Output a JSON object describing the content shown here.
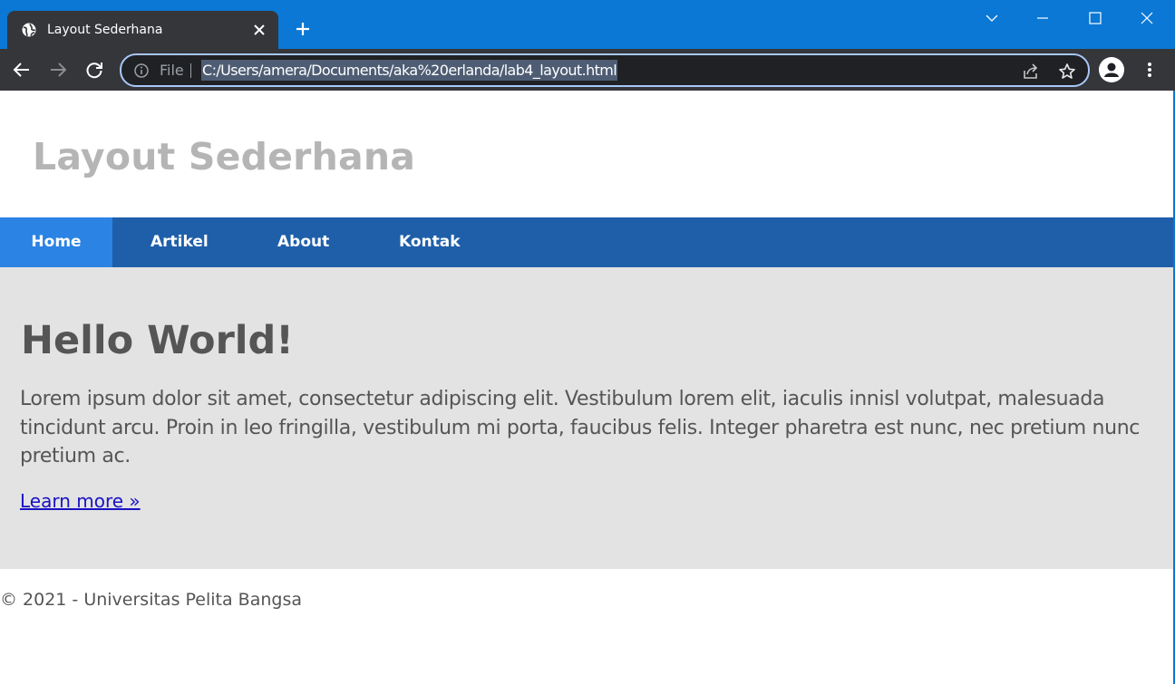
{
  "browser": {
    "tab": {
      "title": "Layout Sederhana"
    },
    "address_bar": {
      "scheme_label": "File",
      "url": "C:/Users/amera/Documents/aka%20erlanda/lab4_layout.html"
    },
    "icons": {
      "favicon": "globe-icon",
      "tab_close": "close-icon",
      "new_tab": "plus-icon",
      "tab_search": "chevron-down-icon",
      "minimize": "minimize-icon",
      "maximize": "maximize-icon",
      "close_window": "close-icon",
      "back": "back-arrow-icon",
      "forward": "forward-arrow-icon",
      "reload": "reload-icon",
      "site_info": "info-icon",
      "share": "share-icon",
      "bookmark": "star-icon",
      "profile": "person-icon",
      "menu": "more-vert-icon"
    },
    "colors": {
      "frame": "#0a78d4",
      "toolbar": "#35363a",
      "omnibox": "#202124"
    }
  },
  "page": {
    "site_title": "Layout Sederhana",
    "nav": {
      "items": [
        {
          "label": "Home",
          "active": true
        },
        {
          "label": "Artikel",
          "active": false
        },
        {
          "label": "About",
          "active": false
        },
        {
          "label": "Kontak",
          "active": false
        }
      ]
    },
    "hero": {
      "title": "Hello World!",
      "text": "Lorem ipsum dolor sit amet, consectetur adipiscing elit. Vestibulum lorem elit, iaculis innisl volutpat, malesuada tincidunt arcu. Proin in leo fringilla, vestibulum mi porta, faucibus felis. Integer pharetra est nunc, nec pretium nunc pretium ac.",
      "link_label": "Learn more »"
    },
    "footer": {
      "text": "© 2021 - Universitas Pelita Bangsa"
    },
    "colors": {
      "nav_bg": "#1f5faa",
      "nav_active": "#2b83e3",
      "hero_bg": "#e3e3e3",
      "title_color": "#b5b5b5",
      "text_color": "#555555",
      "link_color": "#1a12c4"
    }
  }
}
